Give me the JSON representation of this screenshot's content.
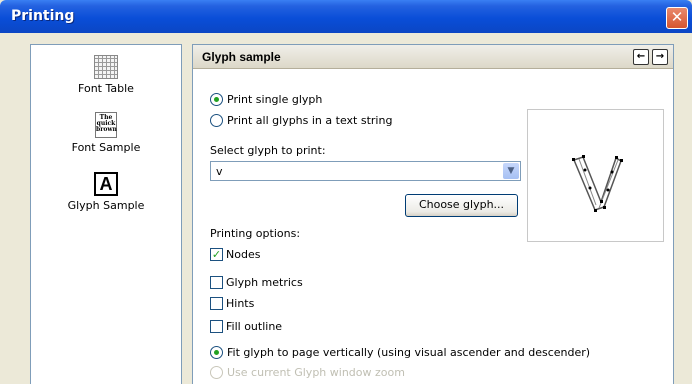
{
  "window": {
    "title": "Printing",
    "close_symbol": "✕"
  },
  "sidebar": {
    "items": [
      {
        "label": "Font Table",
        "icon": "font-table-icon"
      },
      {
        "label": "Font Sample",
        "icon": "font-sample-icon",
        "icon_text": "The quick brown"
      },
      {
        "label": "Glyph Sample",
        "icon": "glyph-sample-icon",
        "icon_text": "A"
      }
    ]
  },
  "panel": {
    "title": "Glyph sample",
    "back_symbol": "←",
    "forward_symbol": "→",
    "options": {
      "print_single": "Print single glyph",
      "print_all": "Print all glyphs in a text string",
      "print_mode_selected": "single"
    },
    "select_label": "Select glyph to print:",
    "glyph_value": "v",
    "choose_button": "Choose glyph...",
    "printing_options_label": "Printing options:",
    "checkboxes": [
      {
        "label": "Nodes",
        "checked": true
      },
      {
        "label": "Glyph metrics",
        "checked": false
      },
      {
        "label": "Hints",
        "checked": false
      },
      {
        "label": "Fill outline",
        "checked": false
      }
    ],
    "fit_vertical": "Fit glyph to page vertically (using visual ascender and descender)",
    "use_zoom": "Use current Glyph window zoom",
    "fit_mode_selected": "vertical"
  },
  "colors": {
    "titlebar": "#0a4ed8",
    "radio_dot": "#21a121",
    "check_mark": "#21a121",
    "panel_border": "#7f9db9"
  }
}
